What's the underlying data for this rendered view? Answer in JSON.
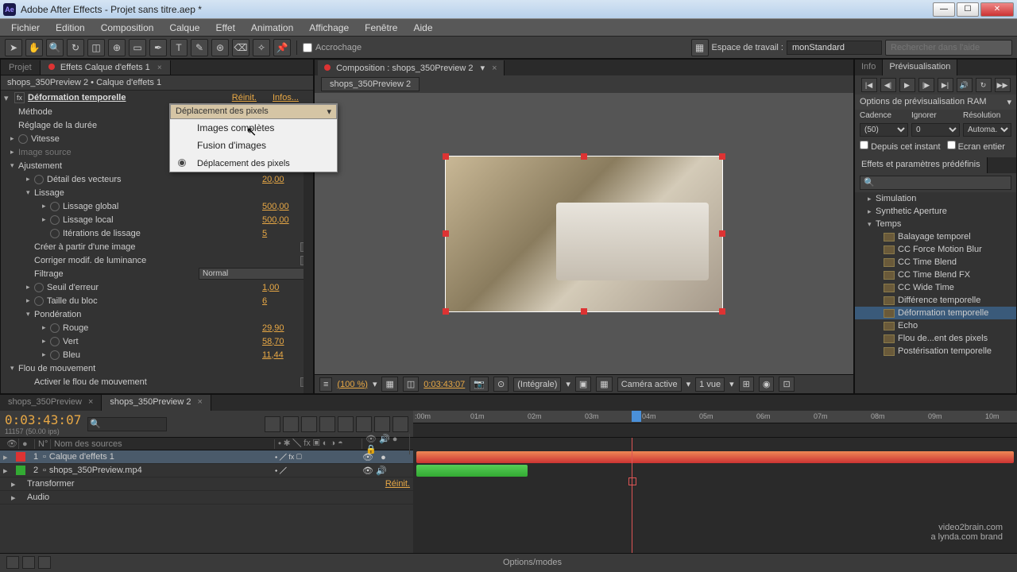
{
  "app": {
    "title": "Adobe After Effects - Projet sans titre.aep *"
  },
  "menu": [
    "Fichier",
    "Edition",
    "Composition",
    "Calque",
    "Effet",
    "Animation",
    "Affichage",
    "Fenêtre",
    "Aide"
  ],
  "toolbar": {
    "snap_label": "Accrochage",
    "workspace_label": "Espace de travail :",
    "workspace_value": "monStandard",
    "search_placeholder": "Rechercher dans l'aide"
  },
  "left": {
    "tab_project": "Projet",
    "tab_effects": "Effets Calque d'effets 1",
    "header": "shops_350Preview 2 • Calque d'effets 1",
    "effect_name": "Déformation temporelle",
    "reset": "Réinit.",
    "infos": "Infos...",
    "props": {
      "methode": "Méthode",
      "methode_value": "Déplacement des pixels",
      "reglage": "Réglage de la durée",
      "vitesse": "Vitesse",
      "image_source": "Image source",
      "ajustement": "Ajustement",
      "detail": "Détail des vecteurs",
      "detail_value": "20,00",
      "lissage": "Lissage",
      "lissage_global": "Lissage global",
      "lissage_global_value": "500,00",
      "lissage_local": "Lissage local",
      "lissage_local_value": "500,00",
      "iterations": "Itérations de lissage",
      "iterations_value": "5",
      "creer": "Créer à partir d'une image",
      "corriger": "Corriger modif. de luminance",
      "filtrage": "Filtrage",
      "filtrage_value": "Normal",
      "seuil": "Seuil d'erreur",
      "seuil_value": "1,00",
      "taille_bloc": "Taille du bloc",
      "taille_bloc_value": "6",
      "ponderation": "Pondération",
      "rouge": "Rouge",
      "rouge_value": "29,90",
      "vert": "Vert",
      "vert_value": "58,70",
      "bleu": "Bleu",
      "bleu_value": "11,44",
      "flou_mouvement": "Flou de mouvement",
      "activer_flou": "Activer le flou de mouvement"
    },
    "dropdown": {
      "current": "Déplacement des pixels",
      "opt1": "Images complètes",
      "opt2": "Fusion d'images",
      "opt3": "Déplacement des pixels"
    }
  },
  "center": {
    "tab": "Composition : shops_350Preview 2",
    "breadcrumb": "shops_350Preview 2",
    "footer": {
      "zoom": "(100 %)",
      "timecode": "0:03:43:07",
      "resolution": "(Intégrale)",
      "camera": "Caméra active",
      "views": "1 vue"
    }
  },
  "right": {
    "tab_info": "Info",
    "tab_preview": "Prévisualisation",
    "ram_options": "Options de prévisualisation RAM",
    "cadence": "Cadence",
    "ignorer": "Ignorer",
    "resolution": "Résolution",
    "cadence_value": "(50)",
    "ignorer_value": "0",
    "resolution_value": "Automa...",
    "depuis": "Depuis cet instant",
    "ecran": "Ecran entier",
    "presets_tab": "Effets et paramètres prédéfinis",
    "tree": {
      "simulation": "Simulation",
      "synthetic": "Synthetic Aperture",
      "temps": "Temps",
      "items": [
        "Balayage temporel",
        "CC Force Motion Blur",
        "CC Time Blend",
        "CC Time Blend FX",
        "CC Wide Time",
        "Différence temporelle",
        "Déformation temporelle",
        "Echo",
        "Flou de...ent des pixels",
        "Postérisation temporelle"
      ]
    }
  },
  "timeline": {
    "tab1": "shops_350Preview",
    "tab2": "shops_350Preview 2",
    "timecode": "0:03:43:07",
    "timecode_sub": "11157 (50.00 ips)",
    "col_num": "N°",
    "col_name": "Nom des sources",
    "layer1": {
      "num": "1",
      "name": "Calque d'effets 1"
    },
    "layer2": {
      "num": "2",
      "name": "shops_350Preview.mp4"
    },
    "transformer": "Transformer",
    "transformer_reset": "Réinit.",
    "audio": "Audio",
    "ruler": [
      ":00m",
      "01m",
      "02m",
      "03m",
      "04m",
      "05m",
      "06m",
      "07m",
      "08m",
      "09m",
      "10m"
    ]
  },
  "statusbar": {
    "options": "Options/modes"
  },
  "watermark": {
    "main": "video2brain.com",
    "sub": "a lynda.com brand"
  }
}
